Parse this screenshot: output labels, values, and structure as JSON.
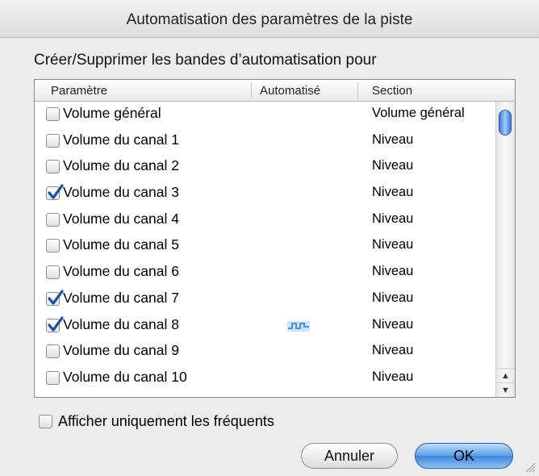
{
  "window": {
    "title": "Automatisation des paramètres de la piste"
  },
  "subtitle": "Créer/Supprimer les bandes d’automatisation pour",
  "table": {
    "columns": [
      "Paramètre",
      "Automatisé",
      "Section"
    ],
    "rows": [
      {
        "name": "Volume général",
        "section": "Volume général",
        "checked": false,
        "automated": false
      },
      {
        "name": "Volume du canal 1",
        "section": "Niveau",
        "checked": false,
        "automated": false
      },
      {
        "name": "Volume du canal 2",
        "section": "Niveau",
        "checked": false,
        "automated": false
      },
      {
        "name": "Volume du canal 3",
        "section": "Niveau",
        "checked": true,
        "automated": false
      },
      {
        "name": "Volume du canal 4",
        "section": "Niveau",
        "checked": false,
        "automated": false
      },
      {
        "name": "Volume du canal 5",
        "section": "Niveau",
        "checked": false,
        "automated": false
      },
      {
        "name": "Volume du canal 6",
        "section": "Niveau",
        "checked": false,
        "automated": false
      },
      {
        "name": "Volume du canal 7",
        "section": "Niveau",
        "checked": true,
        "automated": false
      },
      {
        "name": "Volume du canal 8",
        "section": "Niveau",
        "checked": true,
        "automated": true
      },
      {
        "name": "Volume du canal 9",
        "section": "Niveau",
        "checked": false,
        "automated": false
      },
      {
        "name": "Volume du canal 10",
        "section": "Niveau",
        "checked": false,
        "automated": false
      }
    ]
  },
  "filter": {
    "label": "Afficher uniquement les fréquents",
    "checked": false
  },
  "buttons": {
    "cancel": "Annuler",
    "ok": "OK"
  },
  "icons": {
    "check": "checkmark-icon",
    "automation": "automation-waveform-icon",
    "scroll_up": "scroll-up-arrow-icon",
    "scroll_down": "scroll-down-arrow-icon",
    "resize": "resize-grip-icon"
  },
  "colors": {
    "accent": "#3d85dc",
    "check": "#1d4fa8",
    "automation_icon": "#4a8fd8"
  }
}
